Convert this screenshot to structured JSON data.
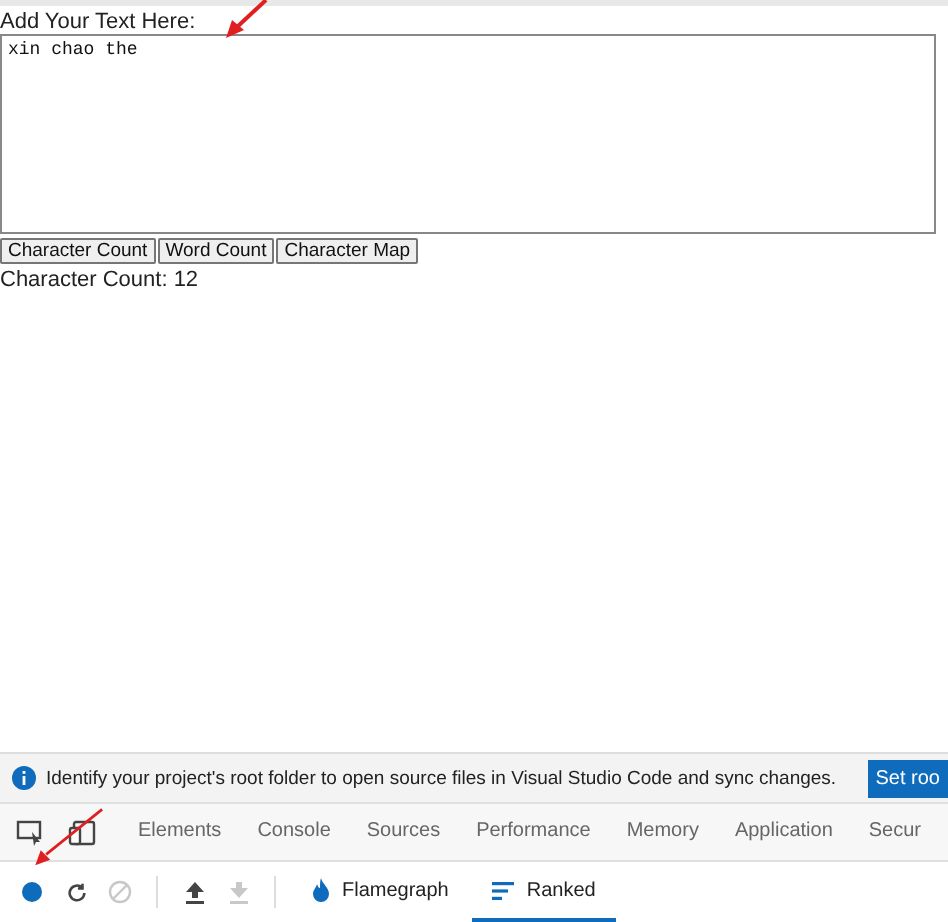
{
  "form": {
    "label": "Add Your Text Here:",
    "text": "xin chao the",
    "buttons": [
      "Character Count",
      "Word Count",
      "Character Map"
    ],
    "result": "Character Count: 12"
  },
  "devtools": {
    "infobar": {
      "message": "Identify your project's root folder to open source files in Visual Studio Code and sync changes.",
      "action": "Set roo"
    },
    "tabs": [
      {
        "label": "Elements",
        "selected": false
      },
      {
        "label": "Console",
        "selected": false
      },
      {
        "label": "Sources",
        "selected": false
      },
      {
        "label": "Performance",
        "selected": false
      },
      {
        "label": "Memory",
        "selected": false
      },
      {
        "label": "Application",
        "selected": false
      },
      {
        "label": "Secur",
        "selected": false
      }
    ],
    "toolbar": [
      {
        "kind": "record",
        "disabled": false
      },
      {
        "kind": "reload",
        "disabled": false
      },
      {
        "kind": "clear",
        "disabled": true
      },
      {
        "kind": "upload",
        "disabled": false
      },
      {
        "kind": "download",
        "disabled": true
      }
    ],
    "views": [
      {
        "kind": "flame",
        "label": "Flamegraph",
        "selected": false
      },
      {
        "kind": "ranked",
        "label": "Ranked",
        "selected": true
      }
    ]
  }
}
